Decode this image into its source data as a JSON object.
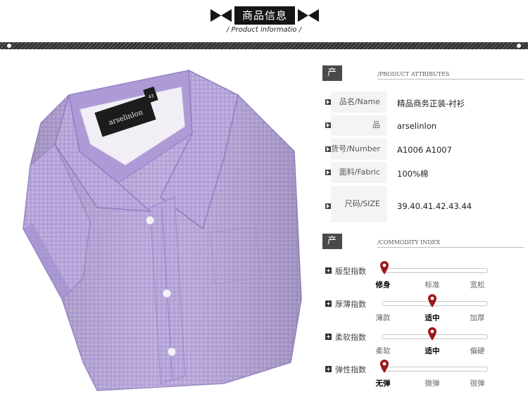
{
  "header": {
    "title": "商品信息",
    "subtitle": "/  Product informatio  /"
  },
  "product_attributes": {
    "title": "产品属性",
    "subtitle": "/PRODUCT ATTRIBUTES",
    "rows": [
      {
        "key": "品名/Name",
        "value": "精品商务正装-衬衫"
      },
      {
        "key": "品牌/Trademark",
        "value": "arselinlon"
      },
      {
        "key": "货号/Number",
        "value": "A1006   A1007"
      },
      {
        "key": "面料/Fabric",
        "value": "100%棉"
      },
      {
        "key": "尺码/SIZE",
        "value": "39.40.41.42.43.44"
      }
    ]
  },
  "commodity_index": {
    "title": "产品指数",
    "subtitle": "/COMMODITY INDEX",
    "rows": [
      {
        "name": "版型指数",
        "options": [
          "修身",
          "标准",
          "宽松"
        ],
        "selected": 0
      },
      {
        "name": "厚薄指数",
        "options": [
          "薄款",
          "适中",
          "加厚"
        ],
        "selected": 1
      },
      {
        "name": "柔软指数",
        "options": [
          "柔软",
          "适中",
          "偏硬"
        ],
        "selected": 1
      },
      {
        "name": "弹性指数",
        "options": [
          "无弹",
          "微弹",
          "很弹"
        ],
        "selected": 0
      }
    ]
  },
  "shirt": {
    "label_text": "arselinlon",
    "size_tag": "43"
  },
  "colors": {
    "dark": "#151515",
    "pin": "#9b1818",
    "shirt": "#b6a4d8"
  }
}
